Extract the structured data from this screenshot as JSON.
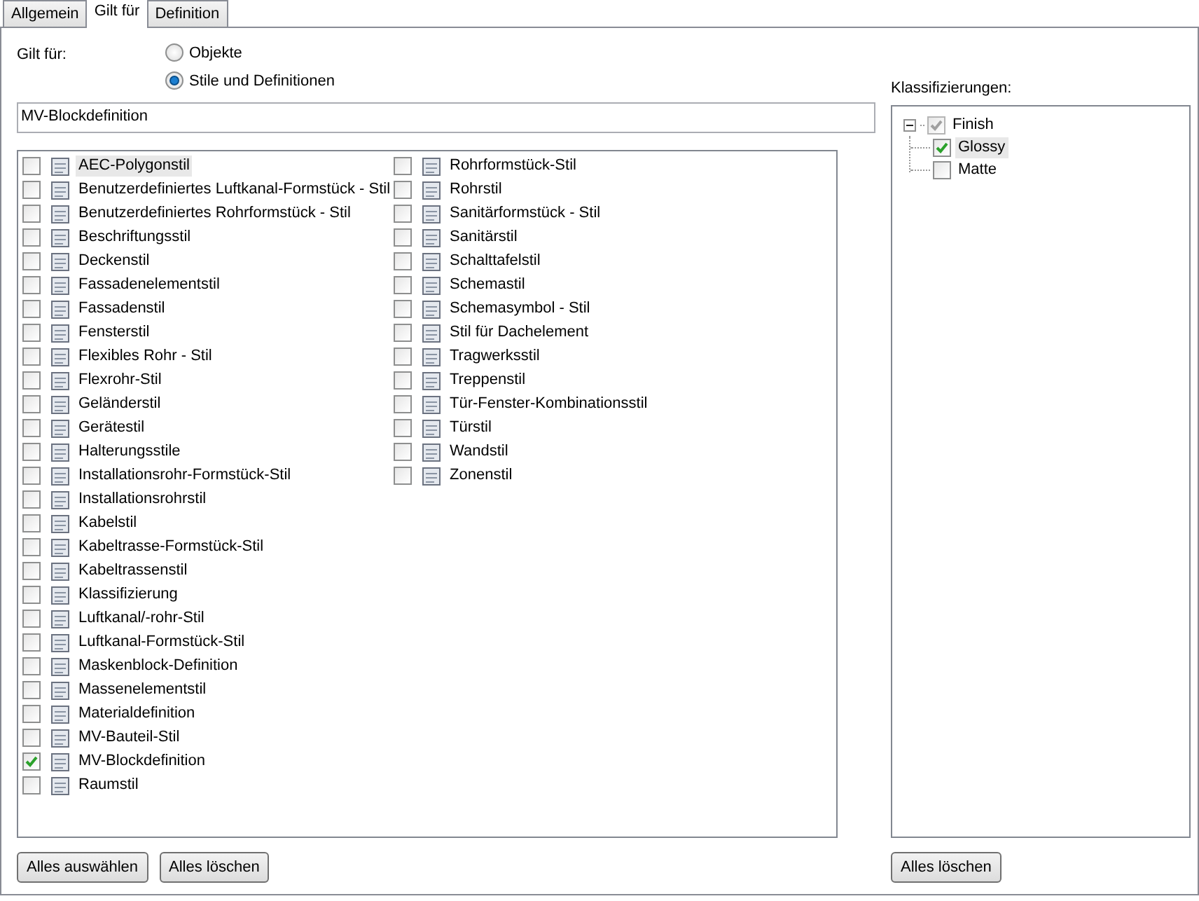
{
  "tabs": [
    {
      "label": "Allgemein",
      "selected": false
    },
    {
      "label": "Gilt für",
      "selected": true
    },
    {
      "label": "Definition",
      "selected": false
    }
  ],
  "applies_to": {
    "label": "Gilt für:",
    "options": [
      {
        "label": "Objekte",
        "selected": false
      },
      {
        "label": "Stile und Definitionen",
        "selected": true
      }
    ]
  },
  "name_field": {
    "value": "MV-Blockdefinition"
  },
  "styles": [
    {
      "label": "AEC-Polygonstil",
      "checked": false,
      "selected": true
    },
    {
      "label": "Benutzerdefiniertes Luftkanal-Formstück - Stil",
      "checked": false,
      "selected": false
    },
    {
      "label": "Benutzerdefiniertes Rohrformstück - Stil",
      "checked": false,
      "selected": false
    },
    {
      "label": "Beschriftungsstil",
      "checked": false,
      "selected": false
    },
    {
      "label": "Deckenstil",
      "checked": false,
      "selected": false
    },
    {
      "label": "Fassadenelementstil",
      "checked": false,
      "selected": false
    },
    {
      "label": "Fassadenstil",
      "checked": false,
      "selected": false
    },
    {
      "label": "Fensterstil",
      "checked": false,
      "selected": false
    },
    {
      "label": "Flexibles Rohr - Stil",
      "checked": false,
      "selected": false
    },
    {
      "label": "Flexrohr-Stil",
      "checked": false,
      "selected": false
    },
    {
      "label": "Geländerstil",
      "checked": false,
      "selected": false
    },
    {
      "label": "Gerätestil",
      "checked": false,
      "selected": false
    },
    {
      "label": "Halterungsstile",
      "checked": false,
      "selected": false
    },
    {
      "label": "Installationsrohr-Formstück-Stil",
      "checked": false,
      "selected": false
    },
    {
      "label": "Installationsrohrstil",
      "checked": false,
      "selected": false
    },
    {
      "label": "Kabelstil",
      "checked": false,
      "selected": false
    },
    {
      "label": "Kabeltrasse-Formstück-Stil",
      "checked": false,
      "selected": false
    },
    {
      "label": "Kabeltrassenstil",
      "checked": false,
      "selected": false
    },
    {
      "label": "Klassifizierung",
      "checked": false,
      "selected": false
    },
    {
      "label": "Luftkanal/-rohr-Stil",
      "checked": false,
      "selected": false
    },
    {
      "label": "Luftkanal-Formstück-Stil",
      "checked": false,
      "selected": false
    },
    {
      "label": "Maskenblock-Definition",
      "checked": false,
      "selected": false
    },
    {
      "label": "Massenelementstil",
      "checked": false,
      "selected": false
    },
    {
      "label": "Materialdefinition",
      "checked": false,
      "selected": false
    },
    {
      "label": "MV-Bauteil-Stil",
      "checked": false,
      "selected": false
    },
    {
      "label": "MV-Blockdefinition",
      "checked": true,
      "selected": false
    },
    {
      "label": "Raumstil",
      "checked": false,
      "selected": false
    },
    {
      "label": "Rohrformstück-Stil",
      "checked": false,
      "selected": false
    },
    {
      "label": "Rohrstil",
      "checked": false,
      "selected": false
    },
    {
      "label": "Sanitärformstück - Stil",
      "checked": false,
      "selected": false
    },
    {
      "label": "Sanitärstil",
      "checked": false,
      "selected": false
    },
    {
      "label": "Schalttafelstil",
      "checked": false,
      "selected": false
    },
    {
      "label": "Schemastil",
      "checked": false,
      "selected": false
    },
    {
      "label": "Schemasymbol - Stil",
      "checked": false,
      "selected": false
    },
    {
      "label": "Stil für Dachelement",
      "checked": false,
      "selected": false
    },
    {
      "label": "Tragwerksstil",
      "checked": false,
      "selected": false
    },
    {
      "label": "Treppenstil",
      "checked": false,
      "selected": false
    },
    {
      "label": "Tür-Fenster-Kombinationsstil",
      "checked": false,
      "selected": false
    },
    {
      "label": "Türstil",
      "checked": false,
      "selected": false
    },
    {
      "label": "Wandstil",
      "checked": false,
      "selected": false
    },
    {
      "label": "Zonenstil",
      "checked": false,
      "selected": false
    }
  ],
  "style_buttons": [
    "Alles auswählen",
    "Alles löschen"
  ],
  "classifications": {
    "label": "Klassifizierungen:",
    "tree": [
      {
        "label": "Finish",
        "checked": true,
        "mixed": true,
        "expanded": true,
        "selected": false,
        "children": [
          {
            "label": "Glossy",
            "checked": true,
            "selected": true
          },
          {
            "label": "Matte",
            "checked": false,
            "selected": false
          }
        ]
      }
    ],
    "button": "Alles löschen"
  }
}
